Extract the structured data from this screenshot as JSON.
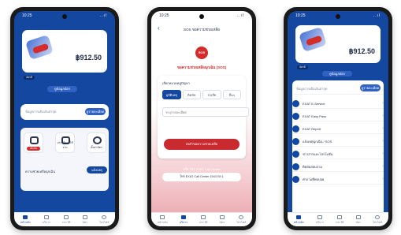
{
  "status": {
    "time": "10:25",
    "signal": "..ıl"
  },
  "phone1": {
    "amount": "฿912.50",
    "badge": "บัตรดี",
    "card_link": "ดูข้อมูลบัตร",
    "notice": "ข้อมูลการเติมเงินล่าสุด",
    "notice_button": "ดูรายละเอียด",
    "services": [
      "เติมเงิน",
      "ประวัติการใช้งาน",
      "ตั้งค่าบัตร"
    ],
    "footer_label": "ความช่วยเหลือฉุกเฉิน",
    "footer_button": "แจ้งเหตุ"
  },
  "phone2": {
    "title": "SOS ขอความช่วยเหลือ",
    "sos_label": "SOS",
    "heading": "ขอความช่วยเหลือฉุกเฉิน (SOS)",
    "section_label": "เลือกหมวดหมู่ปัญหา",
    "tabs": [
      "อุบัติเหตุ",
      "ติดขัด",
      "รถเสีย",
      "อื่นๆ"
    ],
    "input_placeholder": "ระบุรายละเอียด",
    "button": "ส่งคำขอความช่วยเหลือ",
    "hotline_label": "หรือ โทร EXAT Call Center",
    "hotline_button": "โทร EXAT Call Center 1543 กด 1"
  },
  "phone3": {
    "amount": "฿912.50",
    "badge": "บัตรดี",
    "card_link": "ดูข้อมูลบัตร",
    "notice": "ข้อมูลการเติมเงินล่าสุด",
    "notice_button": "ดูรายละเอียด",
    "list": [
      "EXAT E-Service",
      "EXAT Easy Pass",
      "EXAT Report",
      "แจ้งเหตุฉุกเฉิน / SOS",
      "ข่าวสารและโปรโมชั่น",
      "ติดต่อสอบถาม",
      "คำถามที่พบบ่อย"
    ]
  },
  "nav": [
    "หน้าหลัก",
    "บริการ",
    "ประวัติ",
    "บัตร",
    "โปรไฟล์"
  ],
  "colors": {
    "primary": "#1447a0",
    "accent": "#d42b2b"
  }
}
